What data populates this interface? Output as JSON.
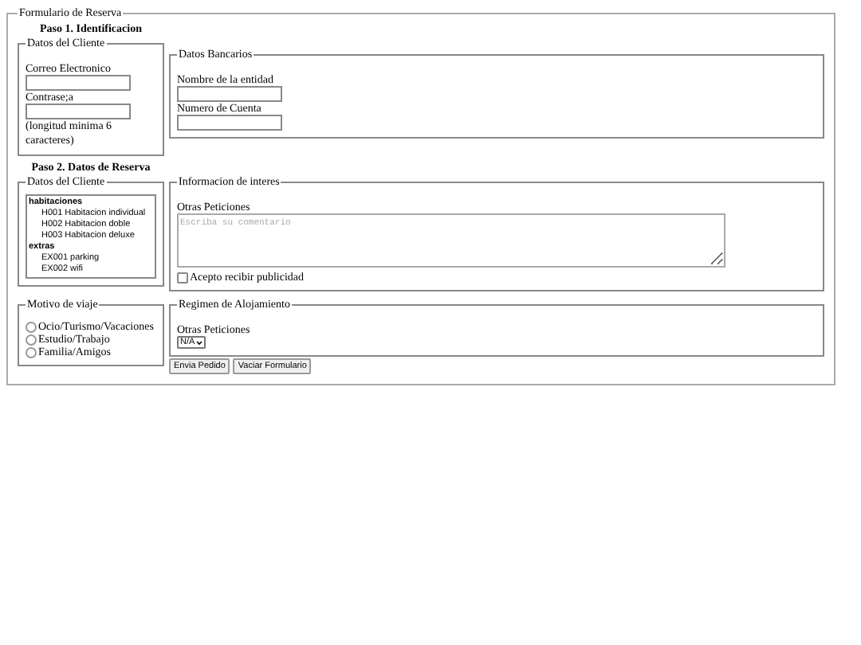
{
  "form": {
    "legend": "Formulario de Reserva"
  },
  "step1": {
    "heading": "Paso 1. Identificacion",
    "client": {
      "legend": "Datos del Cliente",
      "fields": [
        {
          "label": "Correo Electronico"
        },
        {
          "label": "Contrase;a"
        }
      ],
      "note": "(longitud minima 6 caracteres)"
    },
    "bank": {
      "legend": "Datos Bancarios",
      "fields": [
        {
          "label": "Nombre de la entidad"
        },
        {
          "label": "Numero de Cuenta"
        }
      ]
    }
  },
  "step2": {
    "heading": "Paso 2. Datos de Reserva",
    "client": {
      "legend": "Datos del Cliente",
      "groups": [
        {
          "label": "habitaciones",
          "options": [
            "H001 Habitacion individual",
            "H002 Habitacion doble",
            "H003 Habitacion deluxe"
          ]
        },
        {
          "label": "extras",
          "options": [
            "EX001 parking",
            "EX002 wifi"
          ]
        }
      ]
    },
    "info": {
      "legend": "Informacion de interes",
      "label": "Otras Peticiones",
      "placeholder": "Escriba su comentario",
      "checkbox": {
        "label": "Acepto recibir publicidad",
        "checked": false
      }
    },
    "trip": {
      "legend": "Motivo de viaje",
      "options": [
        {
          "label": "Ocio/Turismo/Vacaciones",
          "selected": false
        },
        {
          "label": "Estudio/Trabajo",
          "selected": false
        },
        {
          "label": "Familia/Amigos",
          "selected": false
        }
      ]
    },
    "lodging": {
      "legend": "Regimen de Alojamiento",
      "label": "Otras Peticiones",
      "select": {
        "value": "N/A"
      }
    }
  },
  "buttons": [
    "Envia Pedido",
    "Vaciar Formulario"
  ]
}
